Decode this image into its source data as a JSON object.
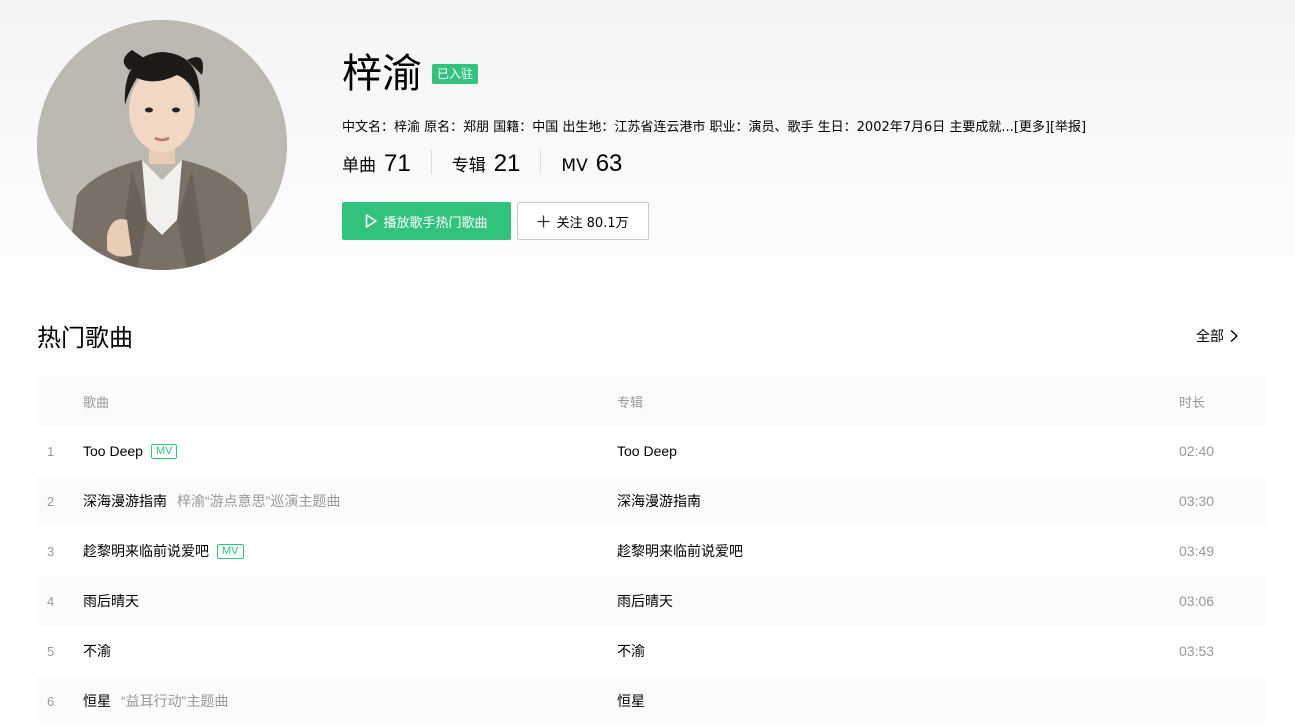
{
  "singer": {
    "name": "梓渝",
    "badge": "已入驻",
    "info": "中文名：梓渝 原名：郑朋 国籍：中国 出生地：江苏省连云港市 职业：演员、歌手 生日：2002年7月6日 主要成就...",
    "more_link": "[更多]",
    "report_link": "[举报]"
  },
  "stats": [
    {
      "label": "单曲",
      "value": "71"
    },
    {
      "label": "专辑",
      "value": "21"
    },
    {
      "label": "MV",
      "value": "63"
    }
  ],
  "actions": {
    "play_hot": "播放歌手热门歌曲",
    "follow": "关注 80.1万"
  },
  "hot_songs": {
    "title": "热门歌曲",
    "view_all": "全部",
    "columns": {
      "song": "歌曲",
      "album": "专辑",
      "duration": "时长"
    },
    "rows": [
      {
        "idx": "1",
        "title": "Too Deep",
        "sub": "",
        "mv": "MV",
        "album": "Too Deep",
        "duration": "02:40"
      },
      {
        "idx": "2",
        "title": "深海漫游指南",
        "sub": "梓渝“游点意思”巡演主题曲",
        "mv": "",
        "album": "深海漫游指南",
        "duration": "03:30"
      },
      {
        "idx": "3",
        "title": "趁黎明来临前说爱吧",
        "sub": "",
        "mv": "MV",
        "album": "趁黎明来临前说爱吧",
        "duration": "03:49"
      },
      {
        "idx": "4",
        "title": "雨后晴天",
        "sub": "",
        "mv": "",
        "album": "雨后晴天",
        "duration": "03:06"
      },
      {
        "idx": "5",
        "title": "不渝",
        "sub": "",
        "mv": "",
        "album": "不渝",
        "duration": "03:53"
      },
      {
        "idx": "6",
        "title": "恒星",
        "sub": "“益耳行动”主题曲",
        "mv": "",
        "album": "恒星",
        "duration": ""
      }
    ]
  },
  "colors": {
    "accent": "#31c27c"
  }
}
